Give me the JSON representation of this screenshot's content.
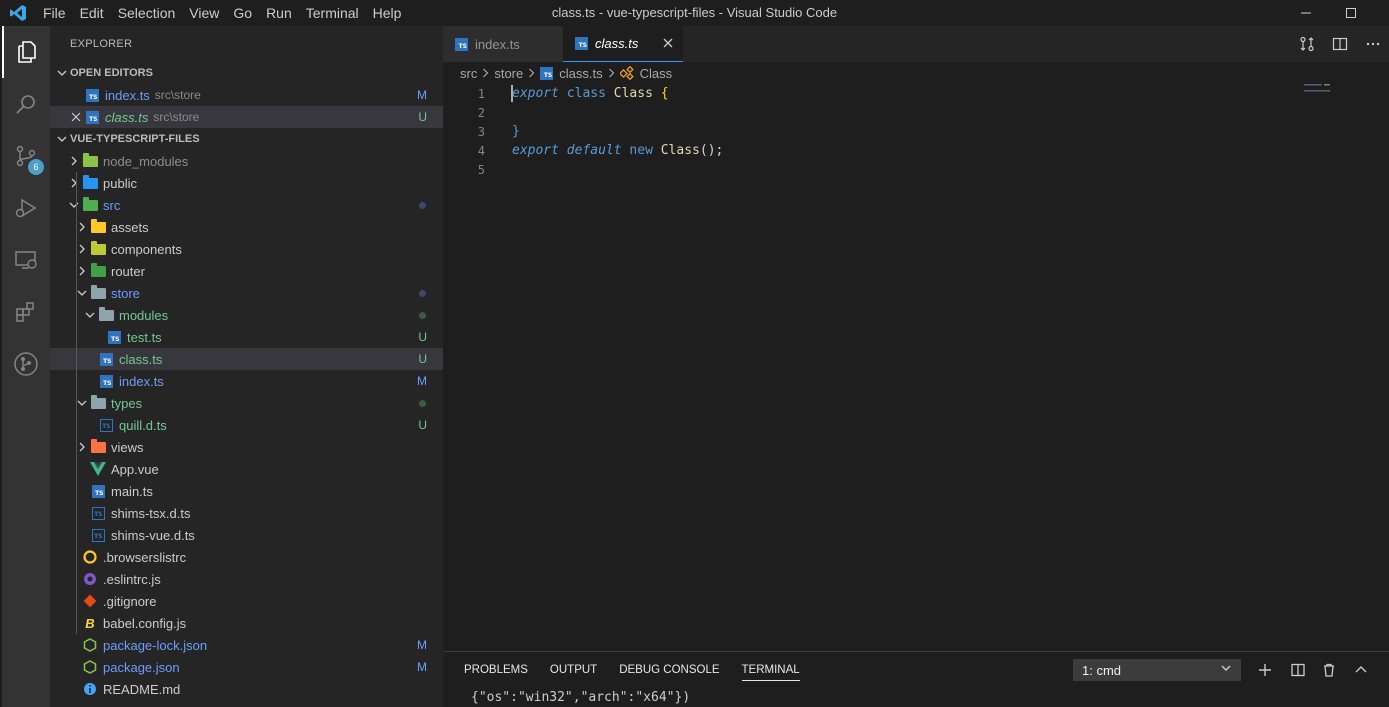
{
  "window": {
    "title": "class.ts - vue-typescript-files - Visual Studio Code",
    "menu": [
      "File",
      "Edit",
      "Selection",
      "View",
      "Go",
      "Run",
      "Terminal",
      "Help"
    ]
  },
  "activity_bar": {
    "items": [
      "explorer-icon",
      "search-icon",
      "source-control-icon",
      "run-debug-icon",
      "remote-explorer-icon",
      "extensions-icon",
      "git-graph-icon"
    ],
    "scm_badge": "6",
    "accent_color": "#4d9ec9"
  },
  "sidebar": {
    "title": "EXPLORER",
    "open_editors": {
      "header": "OPEN EDITORS",
      "items": [
        {
          "name": "index.ts",
          "path": "src\\store",
          "status": "M"
        },
        {
          "name": "class.ts",
          "path": "src\\store",
          "status": "U"
        }
      ]
    },
    "project": {
      "header": "VUE-TYPESCRIPT-FILES",
      "items": [
        {
          "name": "node_modules"
        },
        {
          "name": "public"
        },
        {
          "name": "src"
        },
        {
          "name": "assets"
        },
        {
          "name": "components"
        },
        {
          "name": "router"
        },
        {
          "name": "store"
        },
        {
          "name": "modules"
        },
        {
          "name": "test.ts",
          "status": "U"
        },
        {
          "name": "class.ts",
          "status": "U"
        },
        {
          "name": "index.ts",
          "status": "M"
        },
        {
          "name": "types"
        },
        {
          "name": "quill.d.ts",
          "status": "U"
        },
        {
          "name": "views"
        },
        {
          "name": "App.vue"
        },
        {
          "name": "main.ts"
        },
        {
          "name": "shims-tsx.d.ts"
        },
        {
          "name": "shims-vue.d.ts"
        },
        {
          "name": ".browserslistrc"
        },
        {
          "name": ".eslintrc.js"
        },
        {
          "name": ".gitignore"
        },
        {
          "name": "babel.config.js"
        },
        {
          "name": "package-lock.json",
          "status": "M"
        },
        {
          "name": "package.json",
          "status": "M"
        },
        {
          "name": "README.md"
        }
      ]
    }
  },
  "editor": {
    "tabs": [
      {
        "label": "index.ts"
      },
      {
        "label": "class.ts"
      }
    ],
    "breadcrumbs": [
      "src",
      "store",
      "class.ts",
      "Class"
    ],
    "line_numbers": [
      "1",
      "2",
      "3",
      "4",
      "5"
    ],
    "code": {
      "l1_export": "export",
      "l1_class": "class",
      "l1_name": "Class",
      "l1_brace": "{",
      "l3_brace": "}",
      "l4_export": "export",
      "l4_default": "default",
      "l4_new": "new",
      "l4_name": "Class",
      "l4_call": "();"
    }
  },
  "panel": {
    "tabs": [
      "PROBLEMS",
      "OUTPUT",
      "DEBUG CONSOLE",
      "TERMINAL"
    ],
    "terminal_select": "1: cmd",
    "terminal_output": "{\"os\":\"win32\",\"arch\":\"x64\"})"
  }
}
